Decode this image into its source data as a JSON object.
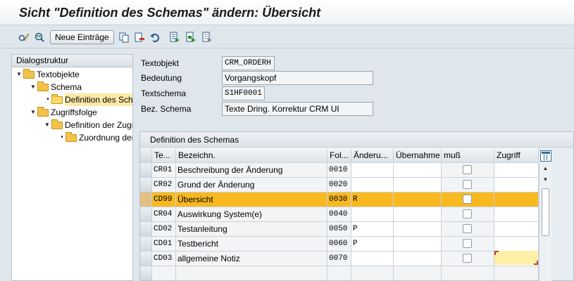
{
  "title": "Sicht \"Definition des Schemas\" ändern: Übersicht",
  "toolbar": {
    "new_entries_label": "Neue Einträge",
    "icons": [
      "display-change-icon",
      "details-icon",
      "copy-icon",
      "delete-icon",
      "undo-icon",
      "select-all-icon",
      "select-block-icon",
      "deselect-all-icon"
    ]
  },
  "dialog": {
    "header": "Dialogstruktur",
    "tree": [
      {
        "label": "Textobjekte",
        "level": 0,
        "expanded": true
      },
      {
        "label": "Schema",
        "level": 1,
        "expanded": true
      },
      {
        "label": "Definition des Schemas",
        "level": 2,
        "selected": true
      },
      {
        "label": "Zugriffsfolge",
        "level": 1,
        "expanded": true
      },
      {
        "label": "Definition der Zugriffsfolge",
        "level": 2,
        "expanded": true
      },
      {
        "label": "Zuordnung der",
        "level": 3
      }
    ]
  },
  "fields": {
    "textobjekt": {
      "label": "Textobjekt",
      "value": "CRM_ORDERH"
    },
    "bedeutung": {
      "label": "Bedeutung",
      "value": "Vorgangskopf"
    },
    "textschema": {
      "label": "Textschema",
      "value": "S1HF0001"
    },
    "bez_schema": {
      "label": "Bez. Schema",
      "value": "Texte Dring. Korrektur CRM UI"
    }
  },
  "table": {
    "title": "Definition des Schemas",
    "columns": [
      "Te...",
      "Bezeichn.",
      "Fol...",
      "Änderu...",
      "Übernahme",
      "muß",
      "Zugriff"
    ],
    "rows": [
      {
        "te": "CR01",
        "bez": "Beschreibung der Änderung",
        "fol": "0010",
        "aend": "",
        "ueb": "",
        "muss": false,
        "zug": ""
      },
      {
        "te": "CR02",
        "bez": "Grund der Änderung",
        "fol": "0020",
        "aend": "",
        "ueb": "",
        "muss": false,
        "zug": ""
      },
      {
        "te": "CD99",
        "bez": "Übersicht",
        "fol": "0030",
        "aend": "R",
        "ueb": "",
        "muss": false,
        "zug": "",
        "highlighted": true
      },
      {
        "te": "CR04",
        "bez": "Auswirkung System(e)",
        "fol": "0040",
        "aend": "",
        "ueb": "",
        "muss": false,
        "zug": ""
      },
      {
        "te": "CD02",
        "bez": "Testanleitung",
        "fol": "0050",
        "aend": "P",
        "ueb": "",
        "muss": false,
        "zug": ""
      },
      {
        "te": "CD01",
        "bez": "Testbericht",
        "fol": "0060",
        "aend": "P",
        "ueb": "",
        "muss": false,
        "zug": ""
      },
      {
        "te": "CD03",
        "bez": "allgemeine Notiz",
        "fol": "0070",
        "aend": "",
        "ueb": "",
        "muss": false,
        "zug": ""
      }
    ]
  },
  "colors": {
    "highlight": "#f8b920",
    "accent": "#f3c24a"
  }
}
